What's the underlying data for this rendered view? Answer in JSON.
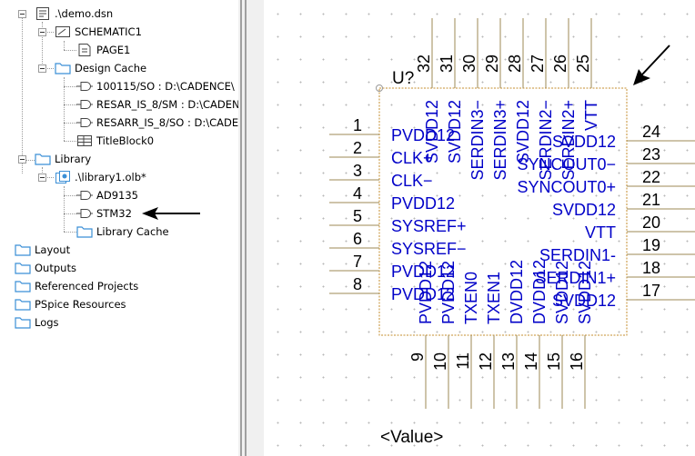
{
  "tree": {
    "items": [
      {
        "name": "tree-node-design-file",
        "label": ".\\demo.dsn",
        "icon": "design-file-icon",
        "level": 0,
        "expander": "minus"
      },
      {
        "name": "tree-node-schematic",
        "label": "SCHEMATIC1",
        "icon": "schematic-folder-icon",
        "level": 1,
        "expander": "minus"
      },
      {
        "name": "tree-node-page",
        "label": "PAGE1",
        "icon": "page-icon",
        "level": 2,
        "expander": "none"
      },
      {
        "name": "tree-node-design-cache",
        "label": "Design Cache",
        "icon": "folder-icon",
        "level": 1,
        "expander": "minus"
      },
      {
        "name": "tree-node-part-100115",
        "label": "100115/SO : D:\\CADENCE\\",
        "icon": "part-icon",
        "level": 2,
        "expander": "none"
      },
      {
        "name": "tree-node-part-resar-sm",
        "label": "RESAR_IS_8/SM : D:\\CADEN",
        "icon": "part-icon",
        "level": 2,
        "expander": "none"
      },
      {
        "name": "tree-node-part-resarr-so",
        "label": "RESARR_IS_8/SO : D:\\CADE",
        "icon": "part-icon",
        "level": 2,
        "expander": "none"
      },
      {
        "name": "tree-node-titleblock",
        "label": "TitleBlock0",
        "icon": "titleblock-icon",
        "level": 2,
        "expander": "none"
      },
      {
        "name": "tree-node-library",
        "label": "Library",
        "icon": "folder-icon",
        "level": 0,
        "expander": "minus"
      },
      {
        "name": "tree-node-library-olb",
        "label": ".\\library1.olb*",
        "icon": "library-file-icon",
        "level": 1,
        "expander": "minus"
      },
      {
        "name": "tree-node-part-ad9135",
        "label": "AD9135",
        "icon": "part-icon",
        "level": 2,
        "expander": "none"
      },
      {
        "name": "tree-node-part-stm32",
        "label": "STM32",
        "icon": "part-icon",
        "level": 2,
        "expander": "none"
      },
      {
        "name": "tree-node-library-cache",
        "label": "Library Cache",
        "icon": "folder-icon",
        "level": 2,
        "expander": "none"
      },
      {
        "name": "tree-node-layout",
        "label": "Layout",
        "icon": "folder-icon",
        "level": -1,
        "expander": "none"
      },
      {
        "name": "tree-node-outputs",
        "label": "Outputs",
        "icon": "folder-icon",
        "level": -1,
        "expander": "none"
      },
      {
        "name": "tree-node-referenced-projects",
        "label": "Referenced Projects",
        "icon": "folder-icon",
        "level": -1,
        "expander": "none"
      },
      {
        "name": "tree-node-pspice-resources",
        "label": "PSpice Resources",
        "icon": "folder-icon",
        "level": -1,
        "expander": "none"
      },
      {
        "name": "tree-node-logs",
        "label": "Logs",
        "icon": "folder-icon",
        "level": -1,
        "expander": "none"
      }
    ]
  },
  "part": {
    "reference": "U?",
    "value": "<Value>",
    "pins_left": [
      {
        "num": "1",
        "name": "PVDD12"
      },
      {
        "num": "2",
        "name": "CLK+"
      },
      {
        "num": "3",
        "name": "CLK−"
      },
      {
        "num": "4",
        "name": "PVDD12"
      },
      {
        "num": "5",
        "name": "SYSREF+"
      },
      {
        "num": "6",
        "name": "SYSREF−"
      },
      {
        "num": "7",
        "name": "PVDD12"
      },
      {
        "num": "8",
        "name": "PVDD12"
      }
    ],
    "pins_bottom": [
      {
        "num": "9",
        "name": "PVDD12"
      },
      {
        "num": "10",
        "name": "PVDD12"
      },
      {
        "num": "11",
        "name": "TXEN0"
      },
      {
        "num": "12",
        "name": "TXEN1"
      },
      {
        "num": "13",
        "name": "DVDD12"
      },
      {
        "num": "14",
        "name": "DVDD12"
      },
      {
        "num": "15",
        "name": "SVDD12"
      },
      {
        "num": "16",
        "name": "SVDD12"
      }
    ],
    "pins_right": [
      {
        "num": "17",
        "name": "SVDD12"
      },
      {
        "num": "18",
        "name": "SERDIN1+"
      },
      {
        "num": "19",
        "name": "SERDIN1-"
      },
      {
        "num": "20",
        "name": "VTT"
      },
      {
        "num": "21",
        "name": "SVDD12"
      },
      {
        "num": "22",
        "name": "SYNCOUT0+"
      },
      {
        "num": "23",
        "name": "SYNCOUT0−"
      },
      {
        "num": "24",
        "name": "SVDD12"
      }
    ],
    "pins_top": [
      {
        "num": "25",
        "name": "VTT"
      },
      {
        "num": "26",
        "name": "SERDIN2+"
      },
      {
        "num": "27",
        "name": "SERDIN2−"
      },
      {
        "num": "28",
        "name": "SVDD12"
      },
      {
        "num": "29",
        "name": "SERDIN3+"
      },
      {
        "num": "30",
        "name": "SERDIN3−"
      },
      {
        "num": "31",
        "name": "SVDD12"
      },
      {
        "num": "32",
        "name": "SVDD12"
      }
    ]
  },
  "colors": {
    "pin_name": "#0000c8",
    "pin_line": "#9c8a55",
    "body_outline": "#c58e2e",
    "annotation_arrow": "#000000"
  }
}
